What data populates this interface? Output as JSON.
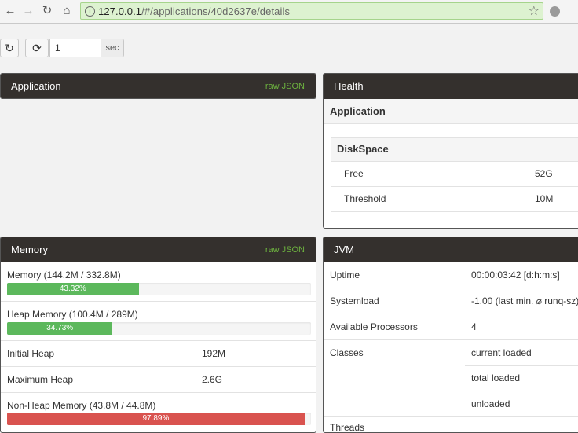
{
  "browser": {
    "url_host": "127.0.0.1",
    "url_path": "/#/applications/40d2637e/details"
  },
  "toolbar": {
    "refresh_icon": "refresh-icon",
    "autorefresh_icon": "sync-icon",
    "interval_value": "1",
    "interval_unit": "sec"
  },
  "application_panel": {
    "title": "Application",
    "raw_json": "raw JSON"
  },
  "health_panel": {
    "title": "Health",
    "section": "Application",
    "subsection": "DiskSpace",
    "rows": [
      {
        "label": "Free",
        "value": "52G"
      },
      {
        "label": "Threshold",
        "value": "10M"
      }
    ]
  },
  "memory_panel": {
    "title": "Memory",
    "raw_json": "raw JSON",
    "memory_label": "Memory (144.2M / 332.8M)",
    "memory_percent": 43.32,
    "memory_percent_label": "43.32%",
    "heap_label": "Heap Memory (100.4M / 289M)",
    "heap_percent": 34.73,
    "heap_percent_label": "34.73%",
    "initial_heap_label": "Initial Heap",
    "initial_heap_value": "192M",
    "max_heap_label": "Maximum Heap",
    "max_heap_value": "2.6G",
    "nonheap_label": "Non-Heap Memory (43.8M / 44.8M)",
    "nonheap_percent": 97.89,
    "nonheap_percent_label": "97.89%"
  },
  "jvm_panel": {
    "title": "JVM",
    "uptime_label": "Uptime",
    "uptime_value": "00:00:03:42 [d:h:m:s]",
    "systemload_label": "Systemload",
    "systemload_value": "-1.00 (last min. ⌀ runq-sz)",
    "processors_label": "Available Processors",
    "processors_value": "4",
    "classes_label": "Classes",
    "classes_current": "current loaded",
    "classes_total": "total loaded",
    "classes_unloaded": "unloaded",
    "threads_label": "Threads"
  },
  "colors": {
    "panel_header": "#34302d",
    "accent_green": "#6db33f",
    "progress_green": "#5cb85c",
    "progress_red": "#d9534f",
    "omnibox_green": "#ddf2d0"
  }
}
